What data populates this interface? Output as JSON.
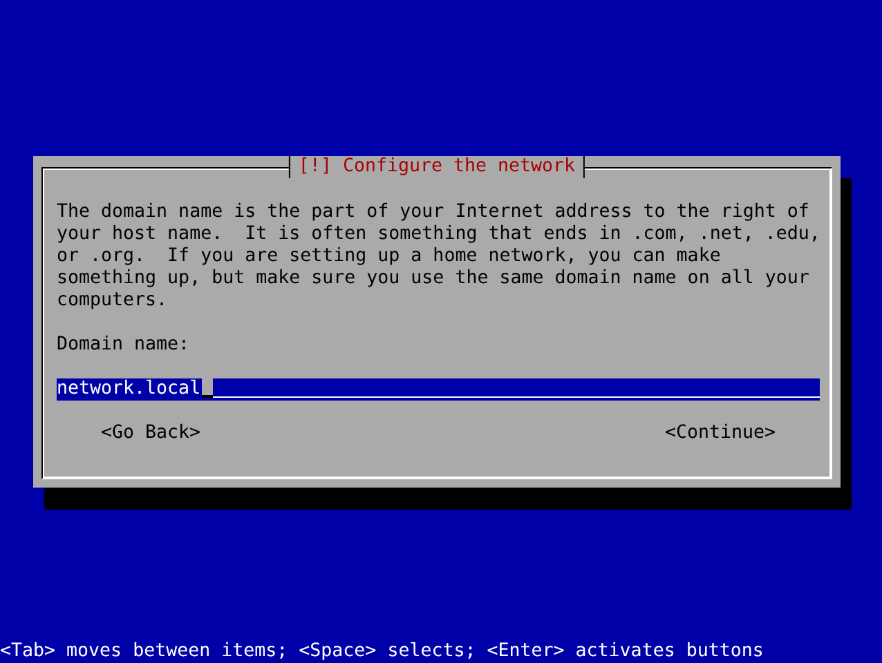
{
  "dialog": {
    "title": "[!] Configure the network",
    "description": "The domain name is the part of your Internet address to the right of your host name.  It is often something that ends in .com, .net, .edu, or .org.  If you are setting up a home network, you can make something up, but make sure you use the same domain name on all your computers.",
    "field": {
      "label": "Domain name:",
      "value": "network.local"
    },
    "buttons": [
      {
        "label": "<Go Back>"
      },
      {
        "label": "<Continue>"
      }
    ]
  },
  "status_bar": "<Tab> moves between items; <Space> selects; <Enter> activates buttons"
}
